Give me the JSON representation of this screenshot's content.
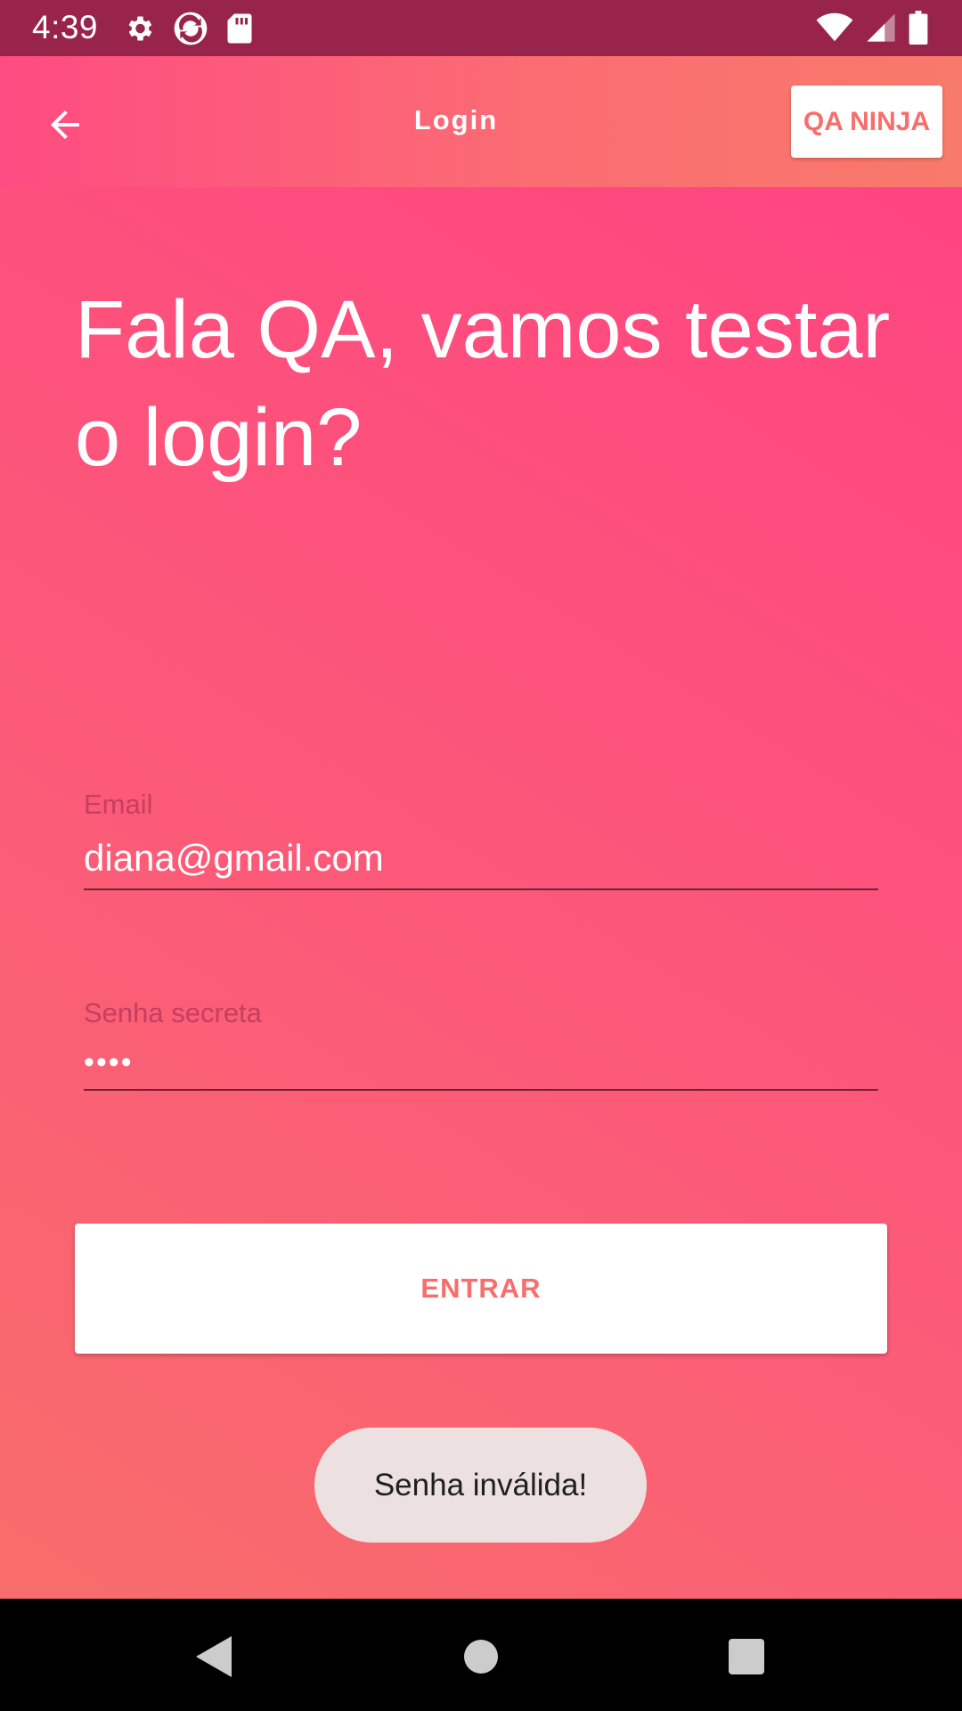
{
  "status_bar": {
    "time": "4:39",
    "icons_left": [
      "settings-icon",
      "sync-app-icon",
      "sd-card-icon"
    ],
    "icons_right": [
      "wifi-icon",
      "cell-signal-icon",
      "battery-icon"
    ]
  },
  "appbar": {
    "title": "Login",
    "back_icon": "arrow-back-icon",
    "action_label": "QA NINJA"
  },
  "main": {
    "headline": "Fala QA, vamos testar o login?",
    "email": {
      "label": "Email",
      "value": "diana@gmail.com"
    },
    "password": {
      "label": "Senha secreta",
      "value": "••••"
    },
    "submit_label": "ENTRAR"
  },
  "toast": {
    "message": "Senha inválida!"
  },
  "nav": {
    "icons": [
      "back-triangle-icon",
      "home-circle-icon",
      "recents-square-icon"
    ]
  },
  "colors": {
    "status_bar": "#98244c",
    "accent": "#f76e6c",
    "gradient_pink": "#ff4481",
    "gradient_coral": "#f86d6b"
  }
}
